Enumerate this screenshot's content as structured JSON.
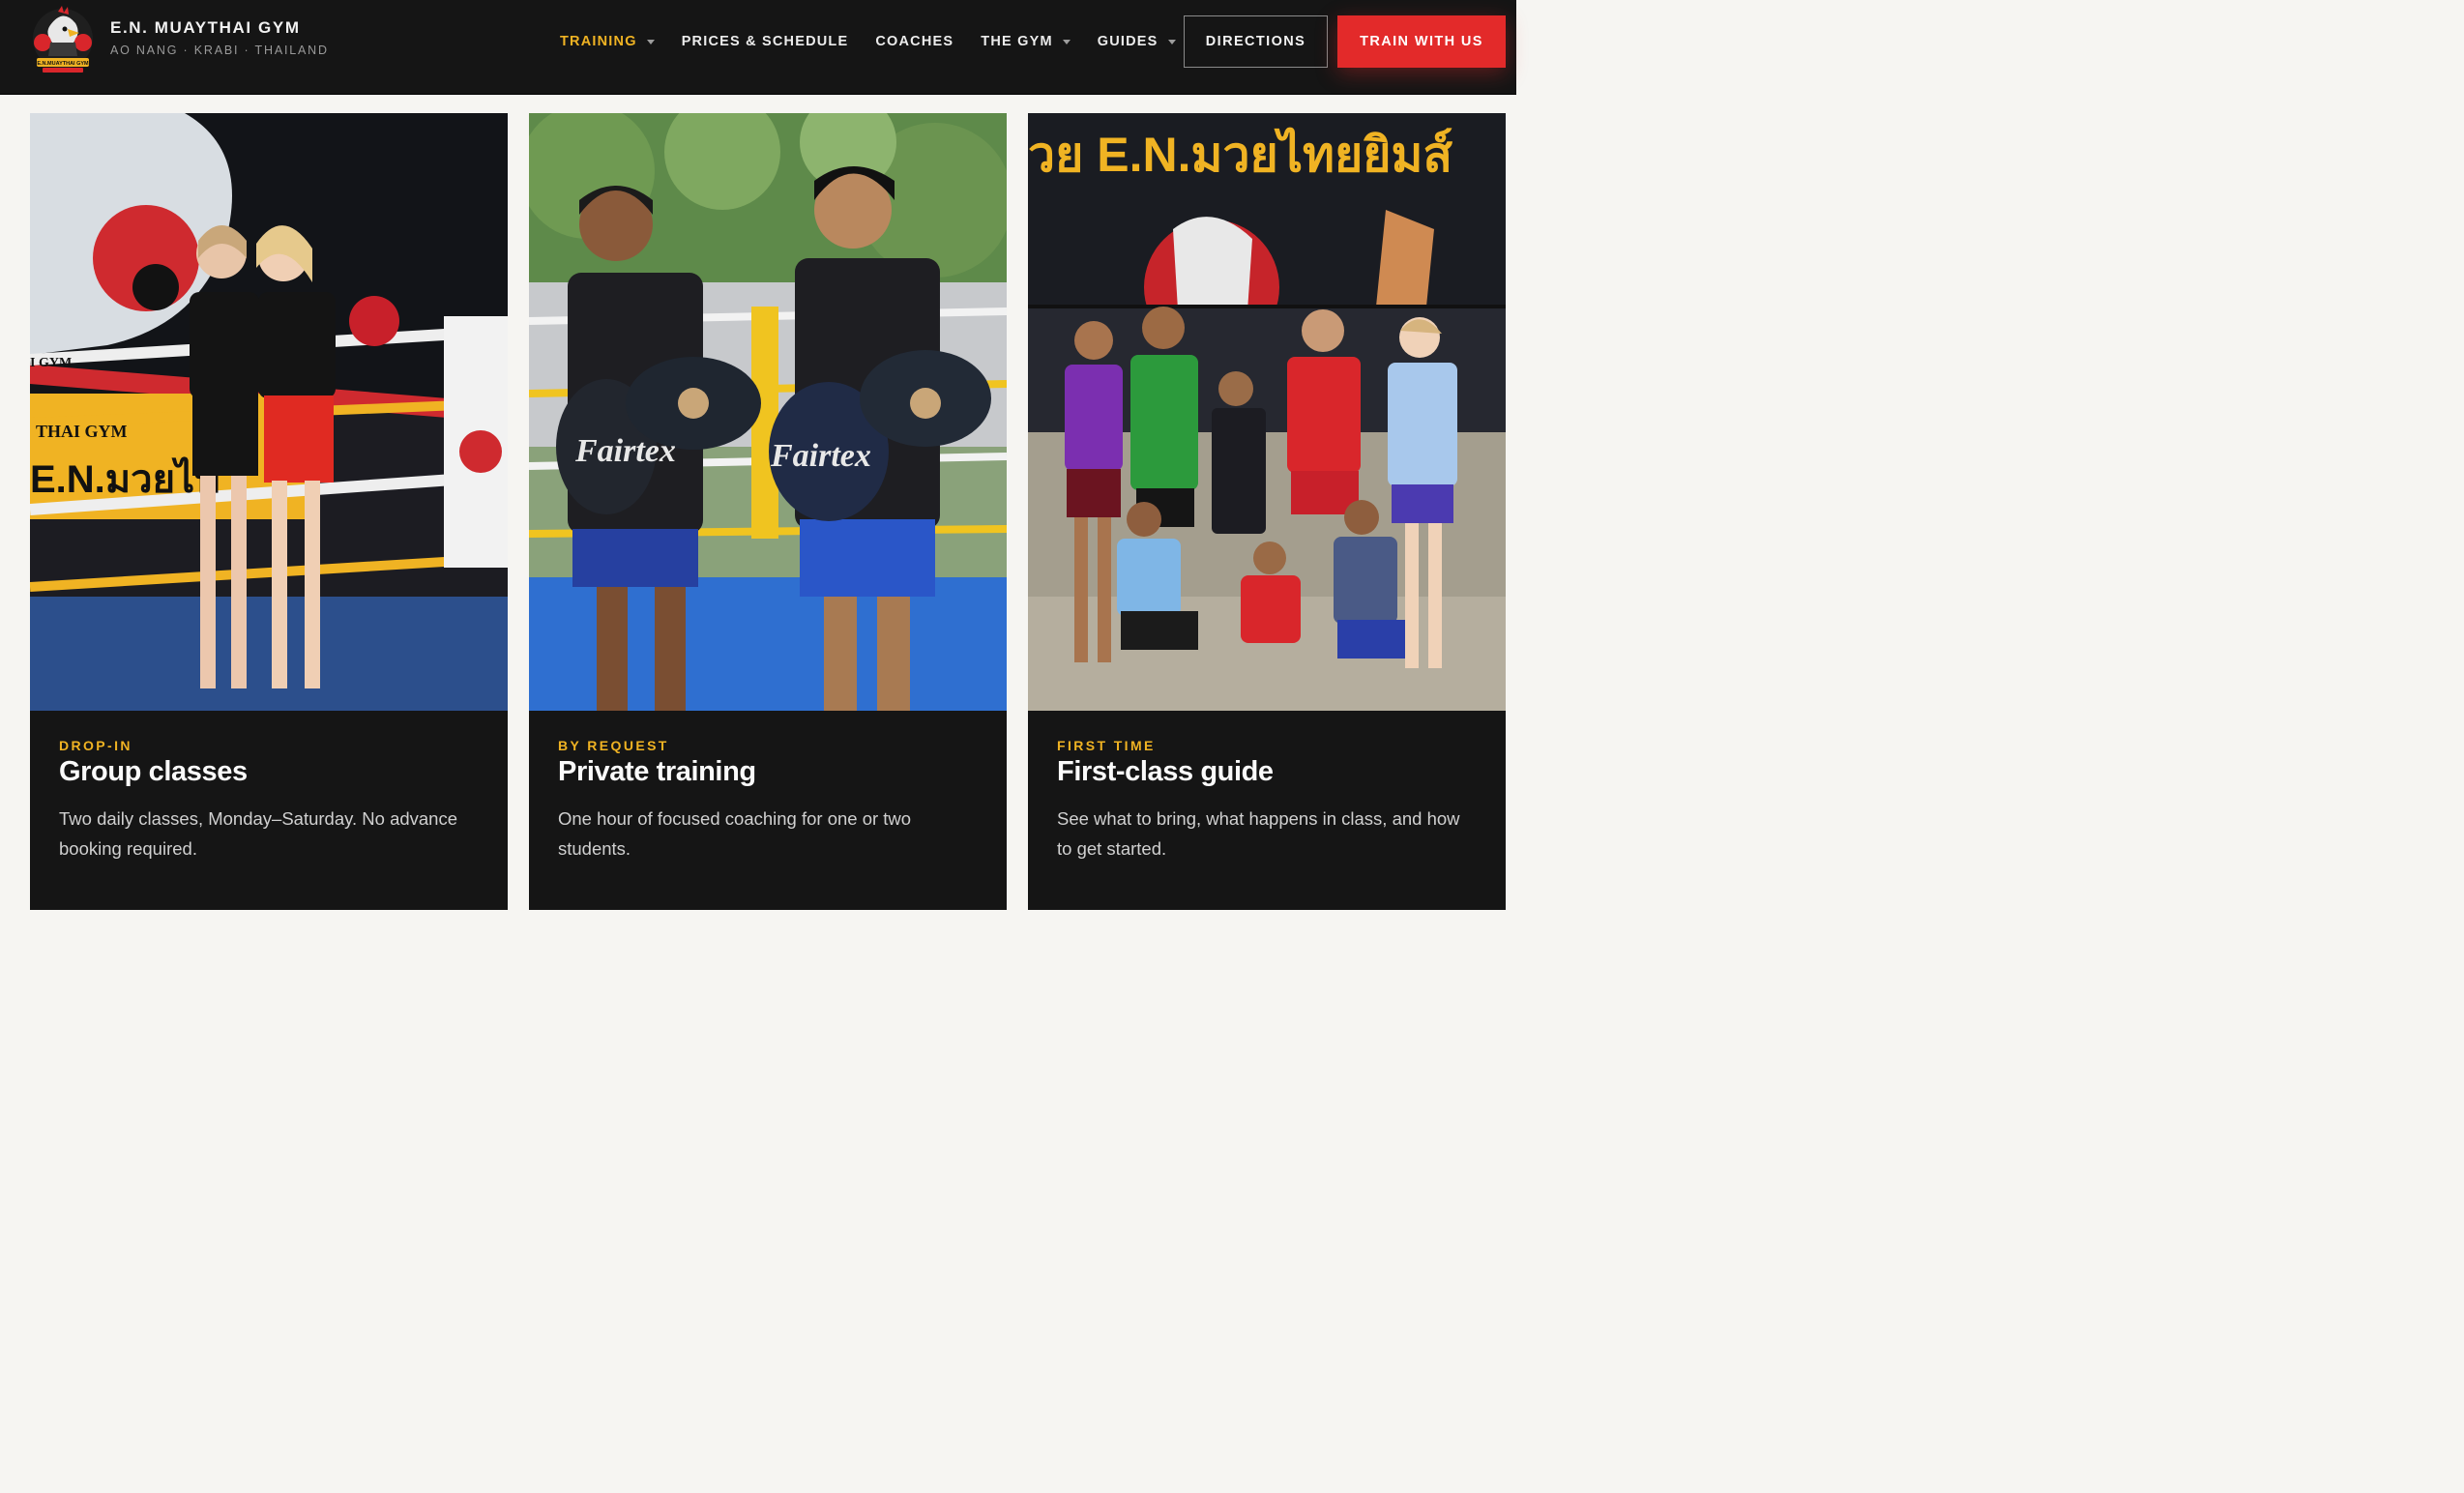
{
  "brand": {
    "name": "E.N. MUAYTHAI GYM",
    "location": "AO NANG · KRABI · THAILAND",
    "logo_text": "E.N.MUAYTHAI GYM"
  },
  "nav": {
    "items": [
      {
        "label": "TRAINING",
        "active": true,
        "dropdown": true
      },
      {
        "label": "PRICES & SCHEDULE",
        "active": false,
        "dropdown": false
      },
      {
        "label": "COACHES",
        "active": false,
        "dropdown": false
      },
      {
        "label": "THE GYM",
        "active": false,
        "dropdown": true
      },
      {
        "label": "GUIDES",
        "active": false,
        "dropdown": true
      }
    ],
    "directions_label": "DIRECTIONS",
    "cta_label": "TRAIN WITH US"
  },
  "cards": [
    {
      "eyebrow": "DROP-IN",
      "title": "Group classes",
      "description": "Two daily classes, Monday–Saturday. No advance booking required.",
      "photo_text": [
        "THAI GYM",
        "I GYM",
        "E.N.มวยไท"
      ]
    },
    {
      "eyebrow": "BY REQUEST",
      "title": "Private training",
      "description": "One hour of focused coaching for one or two students.",
      "photo_text": [
        "Fairtex",
        "Fairtex"
      ]
    },
    {
      "eyebrow": "FIRST TIME",
      "title": "First-class guide",
      "description": "See what to bring, what happens in class, and how to get started.",
      "photo_text": [
        "วย E.N.มวยไทยยิมส์"
      ]
    }
  ],
  "colors": {
    "accent_yellow": "#f0b323",
    "cta_red": "#e32a2a",
    "header_bg": "#151515",
    "page_bg": "#f6f5f2"
  }
}
